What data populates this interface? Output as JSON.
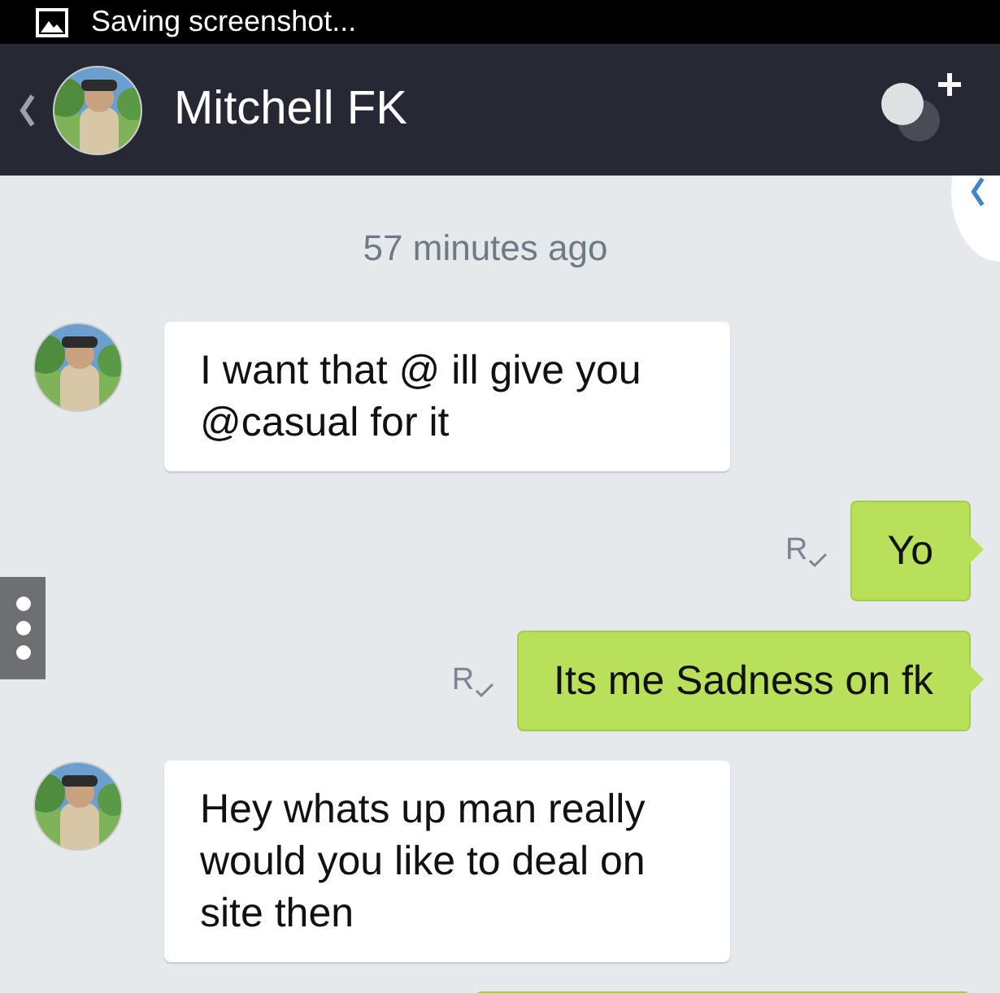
{
  "status_bar": {
    "text": "Saving screenshot..."
  },
  "header": {
    "contact_name": "Mitchell FK"
  },
  "timestamp": "57 minutes ago",
  "messages": [
    {
      "kind": "incoming",
      "text": "I want that @ ill give you @casual for it"
    },
    {
      "kind": "outgoing",
      "text": "Yo",
      "receipt": "R"
    },
    {
      "kind": "outgoing",
      "text": "Its me Sadness on fk",
      "receipt": "R"
    },
    {
      "kind": "incoming",
      "text": "Hey whats up man really would you like to deal on site then"
    },
    {
      "kind": "outgoing"
    }
  ]
}
